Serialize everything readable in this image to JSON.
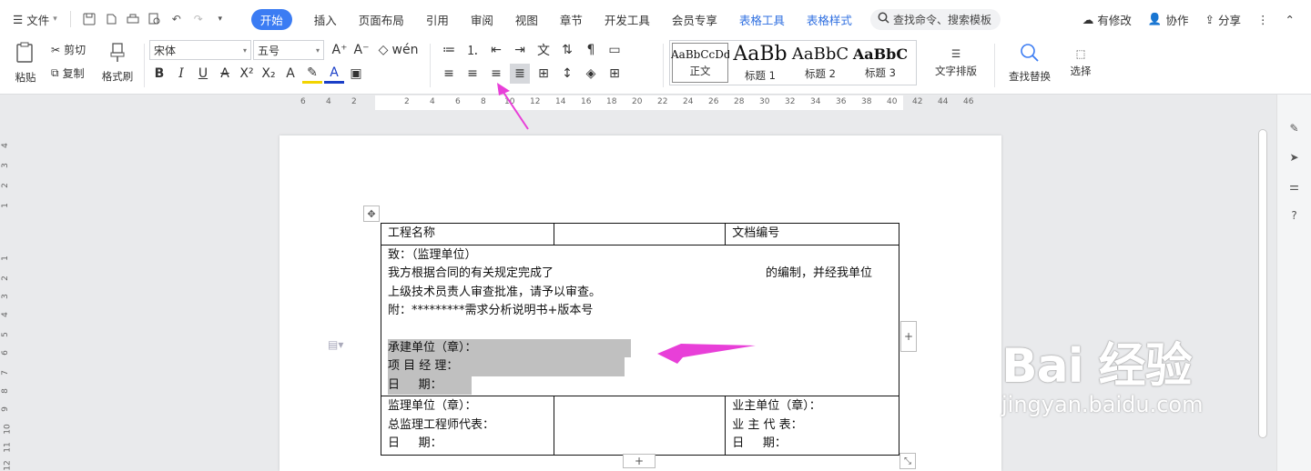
{
  "menu": {
    "file_label": "文件",
    "tabs": [
      "开始",
      "插入",
      "页面布局",
      "引用",
      "审阅",
      "视图",
      "章节",
      "开发工具",
      "会员专享",
      "表格工具",
      "表格样式"
    ],
    "search_placeholder": "查找命令、搜索模板",
    "modified_label": "有修改",
    "collab_label": "协作",
    "share_label": "分享"
  },
  "ribbon": {
    "paste_label": "粘贴",
    "cut_label": "剪切",
    "copy_label": "复制",
    "format_painter_label": "格式刷",
    "font_name": "宋体",
    "font_size": "五号",
    "styles": [
      {
        "sample": "AaBbCcDd",
        "label": "正文"
      },
      {
        "sample": "AaBb",
        "label": "标题 1"
      },
      {
        "sample": "AaBbC",
        "label": "标题 2"
      },
      {
        "sample": "AaBbC",
        "label": "标题 3"
      }
    ],
    "text_layout_label": "文字排版",
    "find_replace_label": "查找替换",
    "select_label": "选择"
  },
  "ruler": {
    "h_ticks": [
      "6",
      "4",
      "2",
      "2",
      "4",
      "6",
      "8",
      "10",
      "12",
      "14",
      "16",
      "18",
      "20",
      "22",
      "24",
      "26",
      "28",
      "30",
      "32",
      "34",
      "36",
      "38",
      "40",
      "42",
      "44",
      "46"
    ],
    "v_ticks": [
      "4",
      "3",
      "2",
      "1",
      "1",
      "2",
      "3",
      "4",
      "5",
      "6",
      "7",
      "8",
      "9",
      "10",
      "11",
      "12"
    ]
  },
  "table": {
    "project_name_label": "工程名称",
    "doc_number_label": "文档编号",
    "to_line": "致：（监理单位）",
    "body_line1_a": "我方根据合同的有关规定完成了",
    "body_line1_b": "的编制，并经我单位",
    "body_line2": "上级技术员责人审查批准，请予以审查。",
    "attachment": "附：*********需求分析说明书+版本号",
    "contractor_unit": "承建单位（章）：",
    "project_manager": "项 目 经 理：",
    "date_label": "日     期：",
    "supervisor_unit": "监理单位（章）：",
    "chief_supervisor": "总监理工程师代表：",
    "owner_unit": "业主单位（章）：",
    "owner_rep": "业 主 代 表："
  },
  "watermark": {
    "brand": "Bai 经验",
    "url": "jingyan.baidu.com"
  },
  "colors": {
    "accent": "#3b7cf3",
    "arrow": "#e83fd8",
    "highlight": "#c0c0c0"
  }
}
